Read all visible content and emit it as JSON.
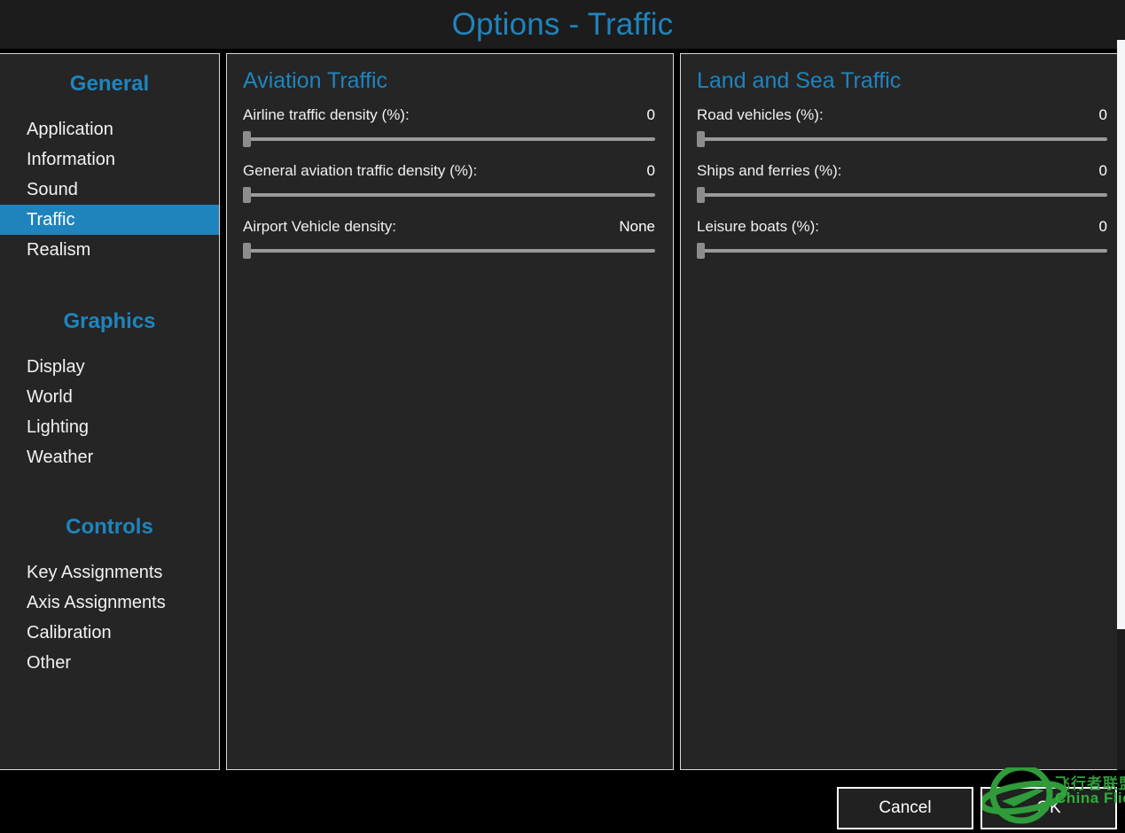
{
  "window": {
    "title": "Options - Traffic",
    "accent_color": "#1f84bd",
    "panel_bg": "#252525",
    "titlebar_bg": "#1c1c1c"
  },
  "sidebar": {
    "groups": [
      {
        "title": "General",
        "items": [
          {
            "label": "Application",
            "selected": false
          },
          {
            "label": "Information",
            "selected": false
          },
          {
            "label": "Sound",
            "selected": false
          },
          {
            "label": "Traffic",
            "selected": true
          },
          {
            "label": "Realism",
            "selected": false
          }
        ]
      },
      {
        "title": "Graphics",
        "items": [
          {
            "label": "Display",
            "selected": false
          },
          {
            "label": "World",
            "selected": false
          },
          {
            "label": "Lighting",
            "selected": false
          },
          {
            "label": "Weather",
            "selected": false
          }
        ]
      },
      {
        "title": "Controls",
        "items": [
          {
            "label": "Key Assignments",
            "selected": false
          },
          {
            "label": "Axis Assignments",
            "selected": false
          },
          {
            "label": "Calibration",
            "selected": false
          },
          {
            "label": "Other",
            "selected": false
          }
        ]
      }
    ]
  },
  "aviation_panel": {
    "title": "Aviation Traffic",
    "settings": [
      {
        "label": "Airline traffic density (%):",
        "value": "0",
        "slider_percent": 0
      },
      {
        "label": "General aviation traffic density (%):",
        "value": "0",
        "slider_percent": 0
      },
      {
        "label": "Airport Vehicle density:",
        "value": "None",
        "slider_percent": 0
      }
    ]
  },
  "landsea_panel": {
    "title": "Land and Sea Traffic",
    "settings": [
      {
        "label": "Road vehicles (%):",
        "value": "0",
        "slider_percent": 0
      },
      {
        "label": "Ships and ferries (%):",
        "value": "0",
        "slider_percent": 0
      },
      {
        "label": "Leisure boats (%):",
        "value": "0",
        "slider_percent": 0
      }
    ]
  },
  "footer": {
    "cancel_label": "Cancel",
    "ok_label": "OK"
  },
  "watermark": {
    "chinese_text": "飞行者联盟",
    "english_text": "China Flier",
    "color": "#2fad3a"
  },
  "scrollbar": {
    "thumb_color": "#f4f6fa",
    "track_color": "#1c1c1c"
  }
}
